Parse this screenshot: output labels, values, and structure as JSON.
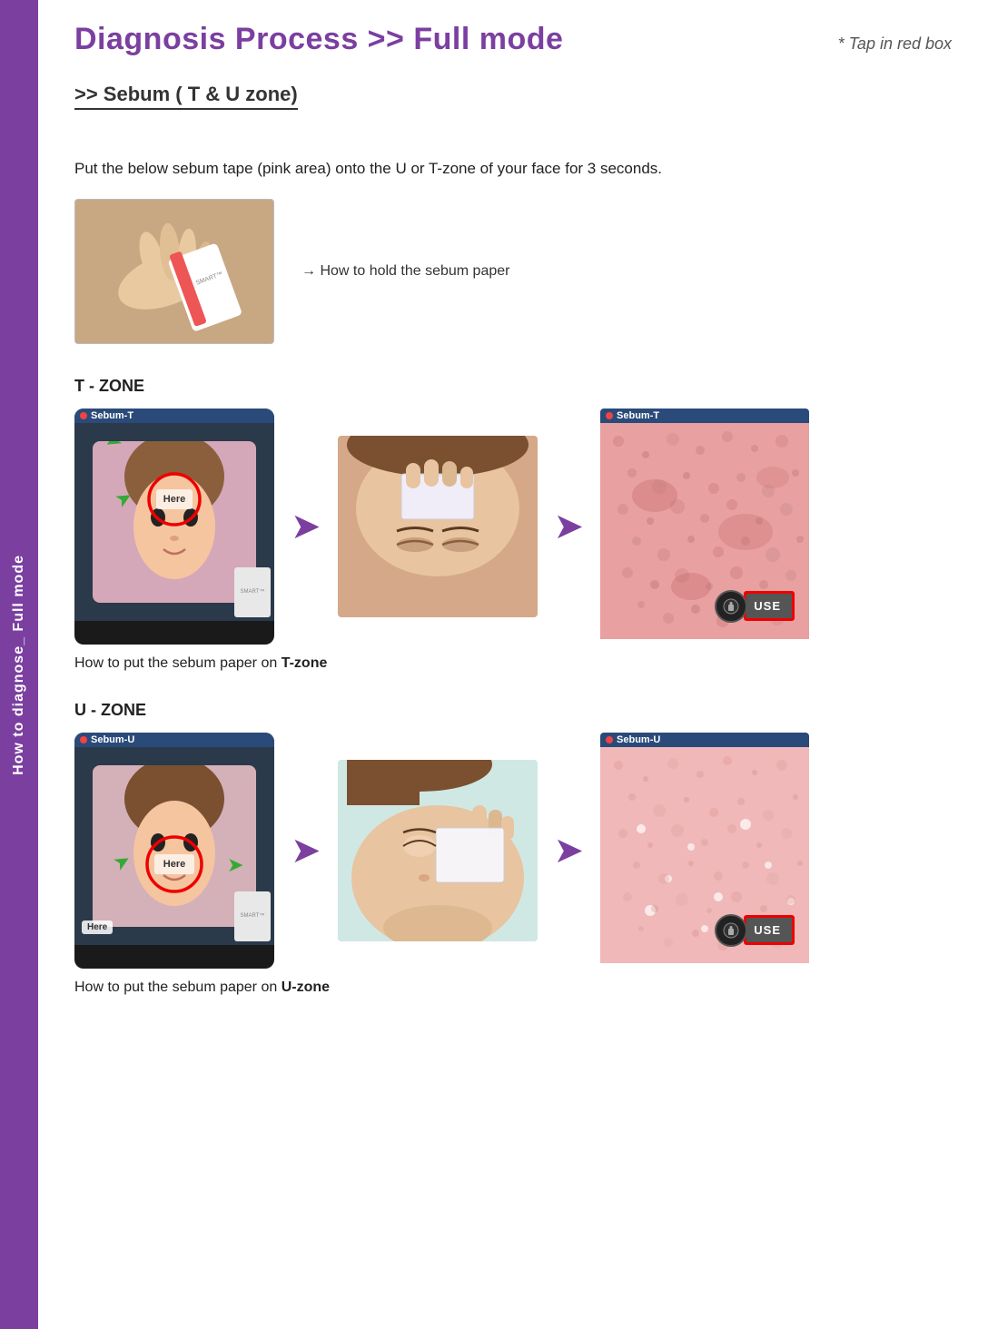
{
  "sidebar": {
    "label": "How to diagnose_  Full mode"
  },
  "header": {
    "title": "Diagnosis Process >> Full mode",
    "note": "* Tap in red box"
  },
  "section": {
    "heading": ">> Sebum ( T & U zone)"
  },
  "intro": {
    "text": "Put the below sebum tape (pink area) onto the U or T-zone of your face for 3 seconds.",
    "caption": "→  How to hold the sebum paper"
  },
  "t_zone": {
    "label": "T - ZONE",
    "phone_label": "Sebum-T",
    "caption_prefix": "How to put the sebum paper on ",
    "caption_zone": "T-zone"
  },
  "u_zone": {
    "label": "U - ZONE",
    "phone_label": "Sebum-U",
    "caption_prefix": "How to put the sebum paper on ",
    "caption_zone": "U-zone"
  },
  "use_button": {
    "label": "USE"
  }
}
